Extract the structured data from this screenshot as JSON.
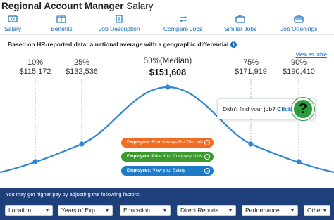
{
  "header": {
    "title_bold": "Regional Account Manager",
    "title_rest": " Salary"
  },
  "tabs": [
    {
      "label": "Salary",
      "icon": "salary-icon"
    },
    {
      "label": "Benefits",
      "icon": "benefits-icon"
    },
    {
      "label": "Job Description",
      "icon": "job-description-icon"
    },
    {
      "label": "Compare Jobs",
      "icon": "compare-jobs-icon"
    },
    {
      "label": "Similar Jobs",
      "icon": "similar-jobs-icon"
    },
    {
      "label": "Job Openings",
      "icon": "job-openings-icon"
    }
  ],
  "data_note": "Based on HR-reported data: a national average with a geographic differential",
  "info_glyph": "i",
  "view_table": "View as table",
  "percentiles": [
    {
      "label": "10%",
      "value": "$115,172"
    },
    {
      "label": "25%",
      "value": "$132,536"
    },
    {
      "label": "50%(Median)",
      "value": "$151,608"
    },
    {
      "label": "75%",
      "value": "$171,919"
    },
    {
      "label": "90%",
      "value": "$190,410"
    }
  ],
  "help": {
    "text": "Didn't find your job? ",
    "link": "Click",
    "glyph": "?"
  },
  "ctas": [
    {
      "bold": "Employers:",
      "text": " Find Surveys For This Job",
      "color": "#f26b21"
    },
    {
      "bold": "Employers:",
      "text": " Price Your Company Jobs",
      "color": "#3d9a2f"
    },
    {
      "bold": "Employees:",
      "text": " View your Salary",
      "color": "#1f7bc8"
    }
  ],
  "cta_arrow": "→",
  "factors": {
    "heading": "You may get higher pay by adjusting the following factors:",
    "selects": [
      "Location",
      "Years of Exp.",
      "Education",
      "Direct Reports",
      "Performance",
      "Other"
    ]
  },
  "colors": {
    "accent": "#1a6fc2",
    "curve": "#2f86d3",
    "bar": "#1d3f7a"
  }
}
